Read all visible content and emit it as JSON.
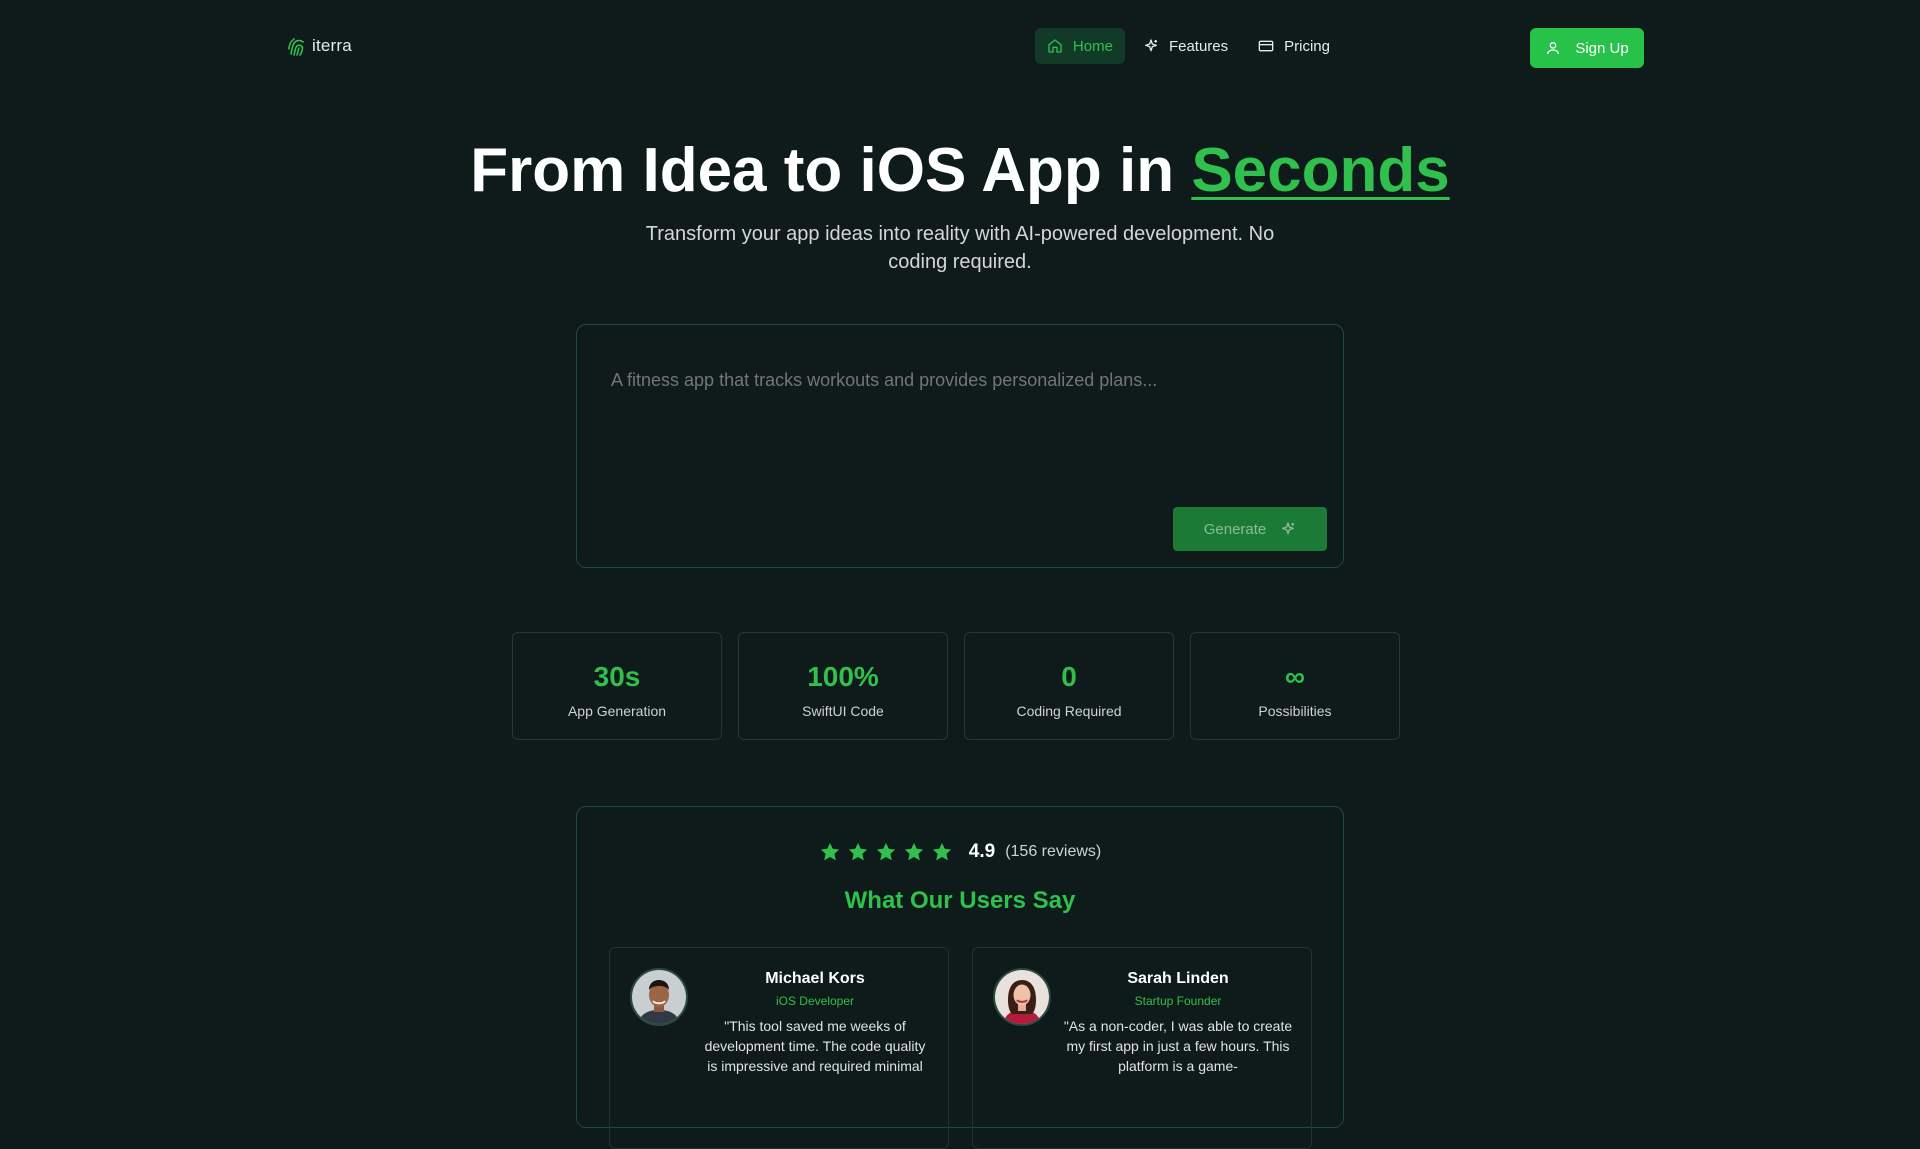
{
  "nav": {
    "logo_text": "iterra",
    "links": [
      {
        "label": "Home",
        "icon": "home-icon"
      },
      {
        "label": "Features",
        "icon": "sparkle-icon"
      },
      {
        "label": "Pricing",
        "icon": "credit-card-icon"
      }
    ],
    "signup_label": "Sign Up",
    "signup_icon": "user-icon"
  },
  "hero": {
    "title_main": "From Idea to iOS App in",
    "title_accent": "Seconds",
    "subtitle": "Transform your app ideas into reality with AI-powered development. No coding required."
  },
  "prompt": {
    "placeholder": "A fitness app that tracks workouts and provides personalized plans...",
    "value": "",
    "generate_label": "Generate",
    "generate_icon": "sparkle-icon"
  },
  "stats": [
    {
      "value": "30s",
      "label": "App Generation"
    },
    {
      "value": "100%",
      "label": "SwiftUI Code"
    },
    {
      "value": "0",
      "label": "Coding Required"
    },
    {
      "value": "∞",
      "label": "Possibilities"
    }
  ],
  "testimonials": {
    "rating_value": "4.9",
    "rating_count": "(156 reviews)",
    "stars": 5,
    "title": "What Our Users Say",
    "cards": [
      {
        "name": "Michael Kors",
        "role": "iOS Developer",
        "quote": "\"This tool saved me weeks of development time. The code quality is impressive and required minimal"
      },
      {
        "name": "Sarah Linden",
        "role": "Startup Founder",
        "quote": "\"As a non-coder, I was able to create my first app in just a few hours. This platform is a game-"
      }
    ]
  },
  "colors": {
    "background": "#0f1a1a",
    "accent": "#2fc04d",
    "button": "#27c24a",
    "generate_button": "#1b7a35"
  }
}
